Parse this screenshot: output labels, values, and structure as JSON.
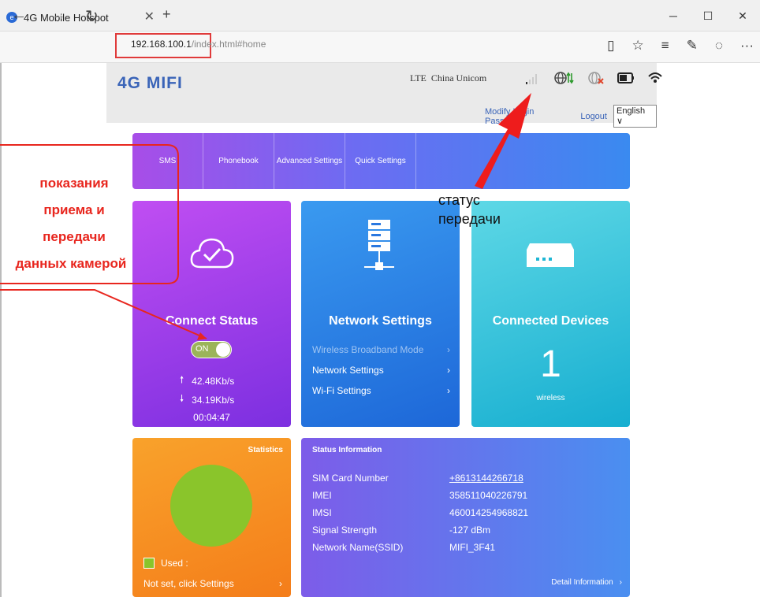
{
  "browser": {
    "tab_title": "4G Mobile Hotspot",
    "tab_close": "✕",
    "new_tab": "+",
    "url_host": "192.168.100.1",
    "url_path": "/index.html#home",
    "win_min": "─",
    "win_max": "☐",
    "win_close": "✕",
    "back": "←",
    "forward": "→",
    "refresh": "↻",
    "reading": "▯",
    "favorite": "☆",
    "hub": "≡",
    "note": "✎",
    "share": "◌",
    "more": "···"
  },
  "header": {
    "logo": "4G MIFI",
    "network_type": "LTE",
    "carrier": "China Unicom",
    "modify_password": "Modify Login Password",
    "logout": "Logout",
    "language": "English ∨"
  },
  "menu": {
    "items": [
      "SMS",
      "Phonebook",
      "Advanced Settings",
      "Quick Settings"
    ]
  },
  "connect": {
    "title": "Connect Status",
    "toggle": "ON",
    "upload": "42.48Kb/s",
    "download": "34.19Kb/s",
    "duration": "00:04:47"
  },
  "network": {
    "title": "Network Settings",
    "items": [
      "Wireless Broadband Mode",
      "Network Settings",
      "Wi-Fi Settings"
    ],
    "chevron": "›"
  },
  "devices": {
    "title": "Connected Devices",
    "count": "1",
    "type": "wireless"
  },
  "statistics": {
    "title": "Statistics",
    "used_label": "Used  :",
    "not_set": "Not set, click Settings",
    "chevron": "›"
  },
  "status_info": {
    "title": "Status Information",
    "rows": [
      {
        "k": "SIM Card Number",
        "v": "+8613144266718"
      },
      {
        "k": "IMEI",
        "v": "358511040226791"
      },
      {
        "k": "IMSI",
        "v": "460014254968821"
      },
      {
        "k": "Signal Strength",
        "v": "-127 dBm"
      },
      {
        "k": "Network Name(SSID)",
        "v": "MIFI_3F41"
      }
    ],
    "detail": "Detail Information",
    "chevron": "›"
  },
  "annotations": {
    "red_lines": [
      "показания",
      "приема и",
      "передачи",
      "данных камерой"
    ],
    "black_lines": [
      "статус",
      "передачи"
    ]
  },
  "colors": {
    "accent": "#3a64b8",
    "annotation_red": "#e8261e",
    "used_green": "#8ac52b"
  }
}
